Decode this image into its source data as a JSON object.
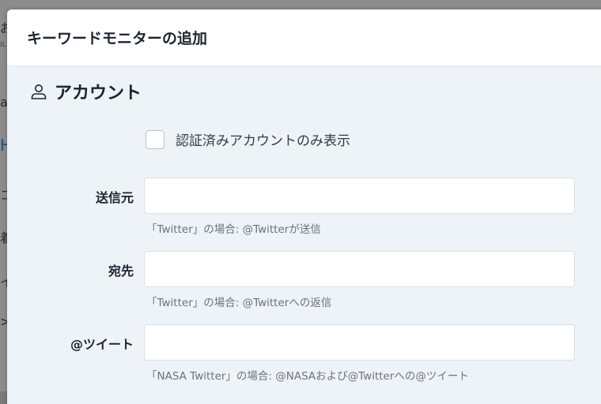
{
  "modal": {
    "title": "キーワードモニターの追加"
  },
  "section": {
    "icon": "user-icon",
    "label": "アカウント"
  },
  "verified_checkbox": {
    "label": "認証済みアカウントのみ表示",
    "checked": false
  },
  "fields": [
    {
      "label": "送信元",
      "value": "",
      "hint": "「Twitter」の場合: @Twitterが送信"
    },
    {
      "label": "宛先",
      "value": "",
      "hint": "「Twitter」の場合: @Twitterへの返信"
    },
    {
      "label": "@ツイート",
      "value": "",
      "hint": "「NASA Twitter」の場合: @NASAおよび@Twitterへの@ツイート"
    }
  ],
  "background_fragments": [
    "お",
    "IL",
    "a",
    "H",
    "コ",
    "着",
    "イ",
    ">"
  ],
  "colors": {
    "modal_bg": "#eef3f8",
    "header_bg": "#ffffff",
    "text_dark": "#1c2430",
    "hint_text": "#6a737d",
    "overlay": "#7a7a7a"
  }
}
